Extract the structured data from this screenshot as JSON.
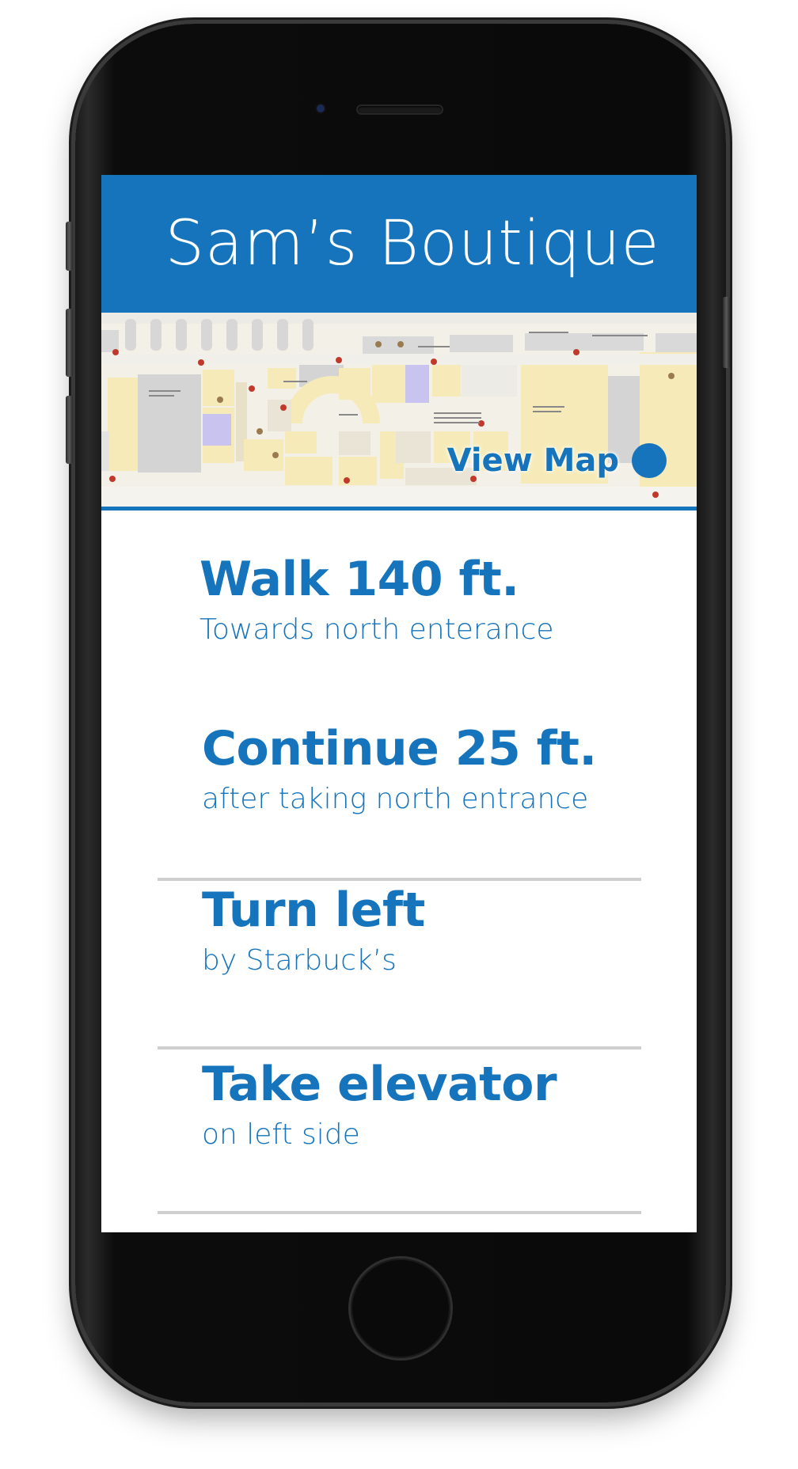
{
  "app": {
    "title": "Sam’s Boutique"
  },
  "map": {
    "view_map_label": "View Map"
  },
  "steps": [
    {
      "title": "Walk 140 ft.",
      "subtitle": "Towards north enterance"
    },
    {
      "title": "Continue 25 ft.",
      "subtitle": "after taking north entrance"
    },
    {
      "title": "Turn left",
      "subtitle": "by Starbuck’s"
    },
    {
      "title": "Take elevator",
      "subtitle": "on left side"
    }
  ],
  "colors": {
    "accent": "#1574bb",
    "divider": "#cfcfcf",
    "device": "#0a0a0a"
  }
}
